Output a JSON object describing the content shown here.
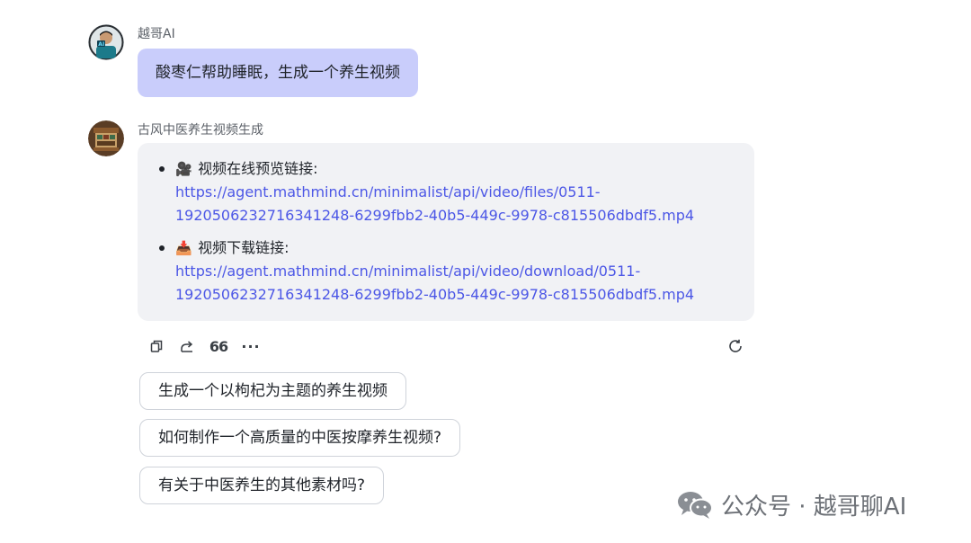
{
  "user_message": {
    "sender": "越哥AI",
    "text": "酸枣仁帮助睡眠，生成一个养生视频"
  },
  "bot_message": {
    "sender": "古风中医养生视频生成",
    "items": [
      {
        "emoji": "🎥",
        "label": "视频在线预览链接:",
        "link_line1": "https://agent.mathmind.cn/minimalist/api/video/files/0511-",
        "link_line2": "1920506232716341248-6299fbb2-40b5-449c-9978-c815506dbdf5.mp4"
      },
      {
        "emoji": "📥",
        "label": "视频下载链接:",
        "link_line1": "https://agent.mathmind.cn/minimalist/api/video/download/0511-",
        "link_line2": "1920506232716341248-6299fbb2-40b5-449c-9978-c815506dbdf5.mp4"
      }
    ]
  },
  "actions": {
    "copy_icon": "copy-icon",
    "share_icon": "share-icon",
    "quote_glyph": "66",
    "more_glyph": "···",
    "regenerate_icon": "refresh-icon"
  },
  "suggestions": [
    "生成一个以枸杞为主题的养生视频",
    "如何制作一个高质量的中医按摩养生视频?",
    "有关于中医养生的其他素材吗?"
  ],
  "watermark": {
    "text": "公众号 · 越哥聊AI",
    "icon": "wechat-icon"
  },
  "colors": {
    "user_bubble": "#c9cdfb",
    "reply_card": "#f1f2f5",
    "link": "#4c57e6"
  }
}
